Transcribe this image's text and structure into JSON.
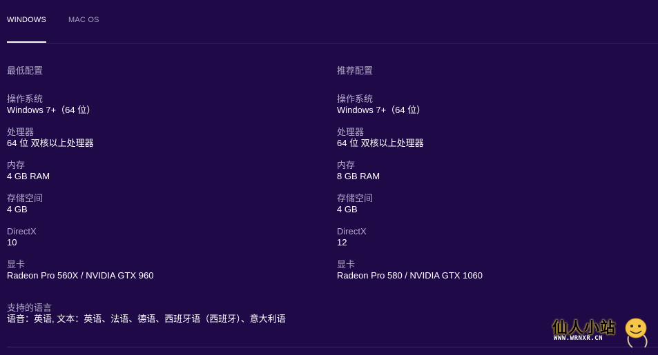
{
  "tabs": [
    {
      "label": "WINDOWS",
      "active": true
    },
    {
      "label": "MAC OS",
      "active": false
    }
  ],
  "minimum": {
    "title": "最低配置",
    "specs": [
      {
        "label": "操作系统",
        "value": "Windows 7+（64 位）"
      },
      {
        "label": "处理器",
        "value": "64 位 双核以上处理器"
      },
      {
        "label": "内存",
        "value": "4 GB RAM"
      },
      {
        "label": "存储空间",
        "value": "4 GB"
      },
      {
        "label": "DirectX",
        "value": "10"
      },
      {
        "label": "显卡",
        "value": "Radeon Pro 560X / NVIDIA GTX 960"
      }
    ]
  },
  "recommended": {
    "title": "推荐配置",
    "specs": [
      {
        "label": "操作系统",
        "value": "Windows 7+（64 位）"
      },
      {
        "label": "处理器",
        "value": "64 位 双核以上处理器"
      },
      {
        "label": "内存",
        "value": "8 GB RAM"
      },
      {
        "label": "存储空间",
        "value": "4 GB"
      },
      {
        "label": "DirectX",
        "value": "12"
      },
      {
        "label": "显卡",
        "value": "Radeon Pro 580 / NVIDIA GTX 1060"
      }
    ]
  },
  "languages": {
    "label": "支持的语言",
    "value": "语音：英语, 文本：英语、法语、德语、西班牙语（西班牙）、意大利语"
  },
  "watermark": {
    "text": "仙人小站",
    "url": "WWW.WRNXR.CN"
  },
  "colors": {
    "background": "#1f0a47",
    "label": "#b3aacb",
    "value": "#ffffff",
    "tab_inactive": "#a89fc2",
    "divider": "#3b2a66"
  }
}
